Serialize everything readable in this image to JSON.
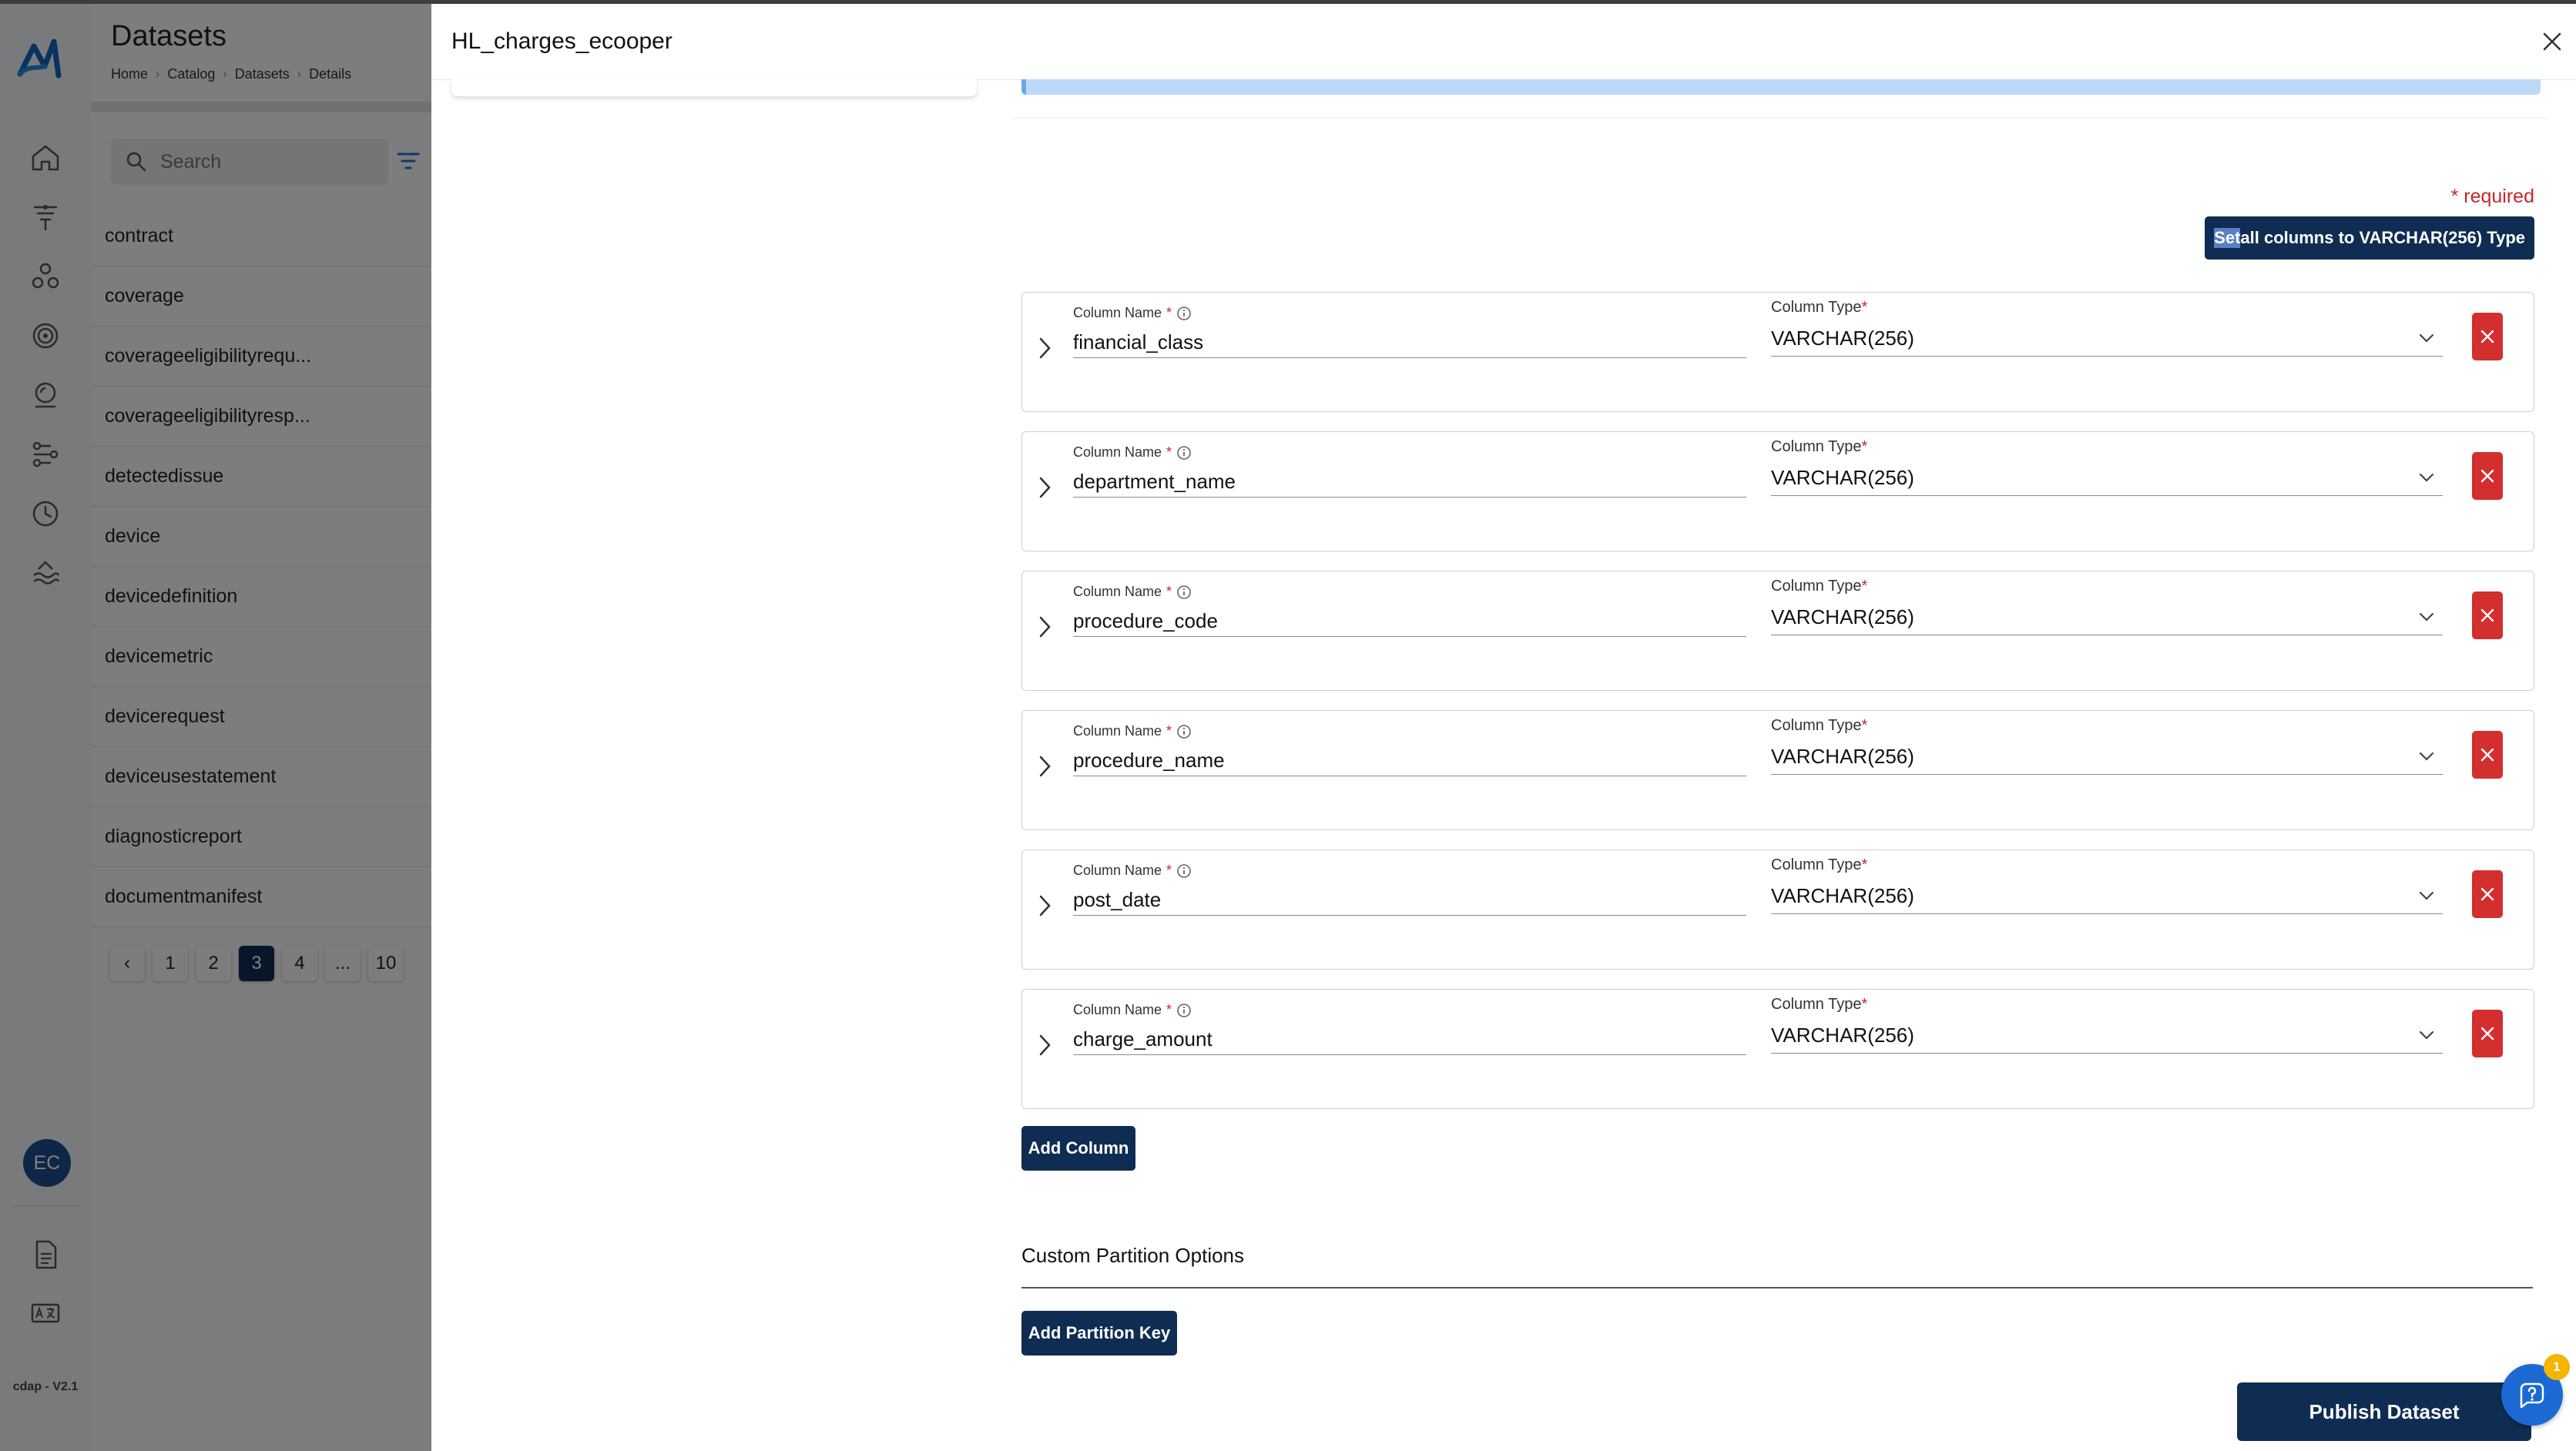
{
  "app": {
    "version": "cdap - V2.1",
    "user_initials": "EC"
  },
  "panel": {
    "title": "Datasets",
    "breadcrumbs": [
      "Home",
      "Catalog",
      "Datasets",
      "Details"
    ],
    "search_placeholder": "Search",
    "items": [
      "contract",
      "coverage",
      "coverageeligibilityrequ...",
      "coverageeligibilityresp...",
      "detectedissue",
      "device",
      "devicedefinition",
      "devicemetric",
      "devicerequest",
      "deviceusestatement",
      "diagnosticreport",
      "documentmanifest"
    ],
    "pages": [
      "1",
      "2",
      "3",
      "4",
      "...",
      "10"
    ],
    "current_page": "3"
  },
  "modal": {
    "title": "HL_charges_ecooper",
    "required_note": "* required",
    "set_all_prefix": "Set",
    "set_all_rest": " all columns to VARCHAR(256) Type",
    "column_name_label": "Column Name",
    "column_type_label": "Column Type",
    "required_star": "*",
    "columns": [
      {
        "name": "financial_class",
        "type": "VARCHAR(256)"
      },
      {
        "name": "department_name",
        "type": "VARCHAR(256)"
      },
      {
        "name": "procedure_code",
        "type": "VARCHAR(256)"
      },
      {
        "name": "procedure_name",
        "type": "VARCHAR(256)"
      },
      {
        "name": "post_date",
        "type": "VARCHAR(256)"
      },
      {
        "name": "charge_amount",
        "type": "VARCHAR(256)"
      }
    ],
    "add_column_label": "Add Column",
    "partition_heading": "Custom Partition Options",
    "add_partition_label": "Add Partition Key",
    "publish_label": "Publish Dataset",
    "help_badge_count": "1"
  },
  "colors": {
    "primary": "#0f2d52",
    "danger": "#d32f2f",
    "accent": "#1c69d4",
    "badge": "#f4b400"
  }
}
